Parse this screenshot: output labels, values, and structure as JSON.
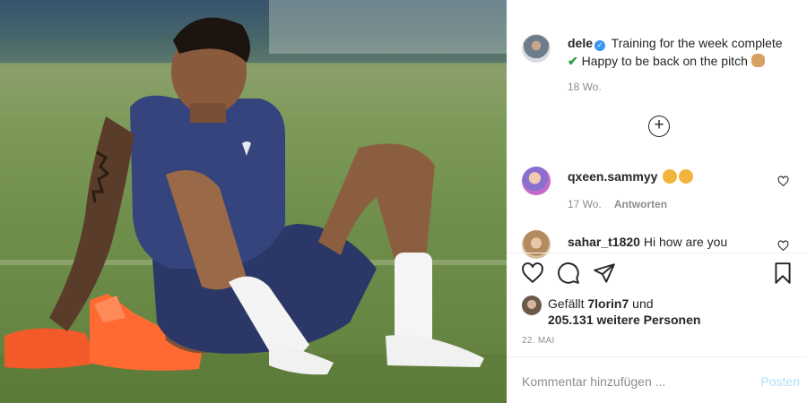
{
  "post": {
    "username": "dele",
    "caption_line1": "Training for the week complete",
    "caption_line2": "Happy to be back on the pitch",
    "posted_ago": "18 Wo."
  },
  "comments": [
    {
      "username": "qxeen.sammyy",
      "text": "",
      "ago": "17 Wo.",
      "reply_label": "Antworten"
    },
    {
      "username": "sahar_t1820",
      "text": "Hi how are you"
    }
  ],
  "likes": {
    "prefix": "Gefällt",
    "user": "7lorin7",
    "conjunction": "und",
    "count_text": "205.131 weitere Personen"
  },
  "date": "22. MAI",
  "comment_input": {
    "placeholder": "Kommentar hinzufügen ...",
    "post_label": "Posten"
  },
  "icons": {
    "verified": "verified-badge-icon",
    "load_more": "plus-circle-icon",
    "like": "heart-icon",
    "comment": "comment-icon",
    "share": "share-icon",
    "save": "bookmark-icon"
  },
  "colors": {
    "link_blue": "#3897f0",
    "post_button_disabled": "#b2dffc",
    "meta_gray": "#8e8e8e"
  }
}
